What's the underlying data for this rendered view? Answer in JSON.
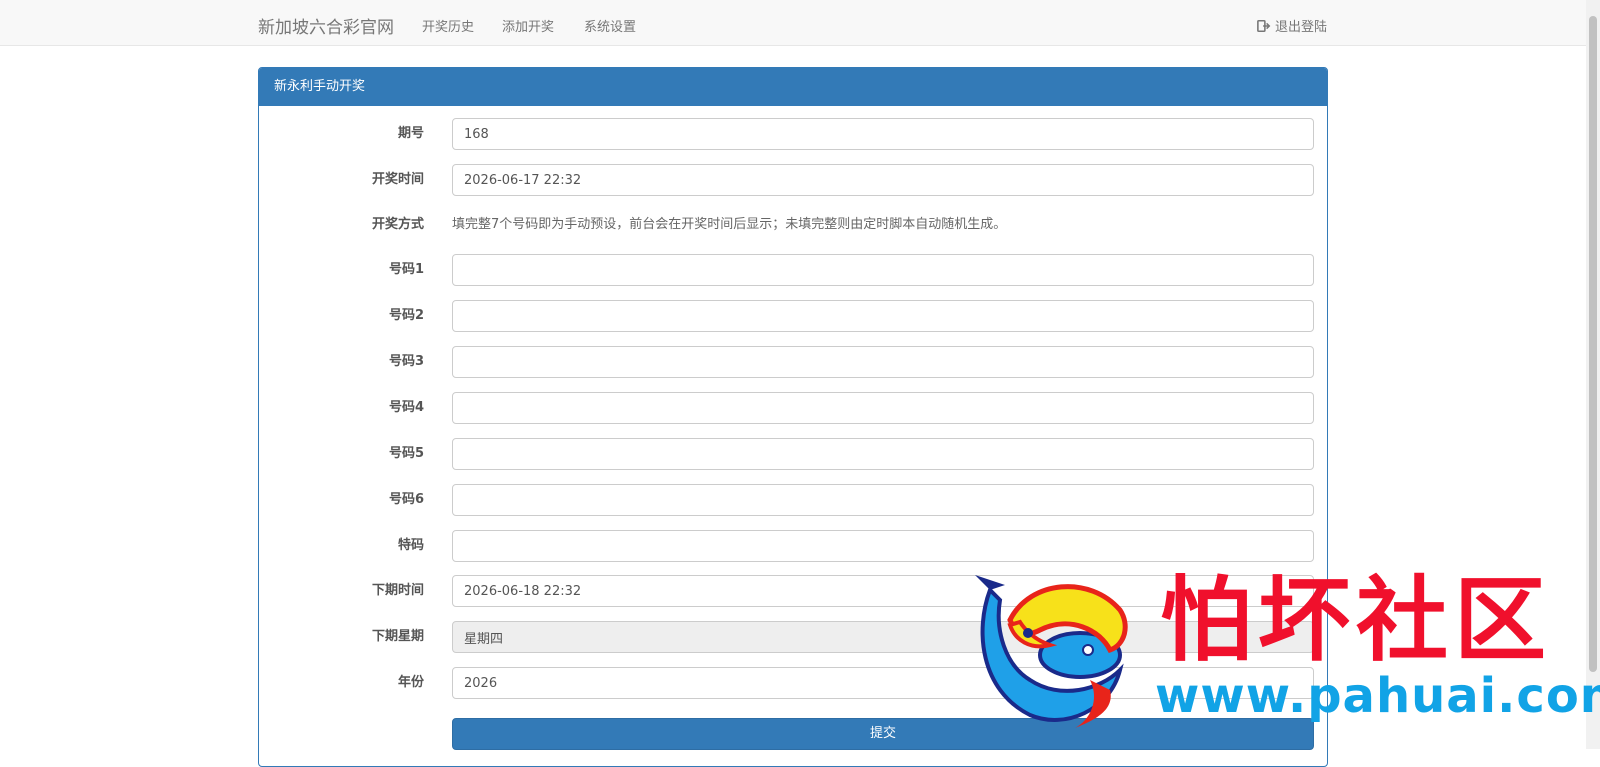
{
  "navbar": {
    "brand": "新加坡六合彩官网",
    "items": [
      "开奖历史",
      "添加开奖",
      "系统设置"
    ],
    "logout": "退出登陆"
  },
  "panel": {
    "title": "新永利手动开奖"
  },
  "form": {
    "issue": {
      "label": "期号",
      "value": "168"
    },
    "draw_time": {
      "label": "开奖时间",
      "value": "2026-06-17 22:32"
    },
    "draw_method": {
      "label": "开奖方式",
      "text": "填完整7个号码即为手动预设，前台会在开奖时间后显示；未填完整则由定时脚本自动随机生成。"
    },
    "numbers": [
      {
        "label": "号码1",
        "value": ""
      },
      {
        "label": "号码2",
        "value": ""
      },
      {
        "label": "号码3",
        "value": ""
      },
      {
        "label": "号码4",
        "value": ""
      },
      {
        "label": "号码5",
        "value": ""
      },
      {
        "label": "号码6",
        "value": ""
      }
    ],
    "special": {
      "label": "特码",
      "value": ""
    },
    "next_time": {
      "label": "下期时间",
      "value": "2026-06-18 22:32"
    },
    "next_weekday": {
      "label": "下期星期",
      "value": "星期四"
    },
    "year": {
      "label": "年份",
      "value": "2026"
    },
    "submit": "提交"
  },
  "watermark": {
    "title": "怕坏社区",
    "url": "www.pahuai.com"
  },
  "colors": {
    "primary": "#337ab7",
    "watermark_red": "#f0102c",
    "watermark_blue": "#11a3e6"
  }
}
